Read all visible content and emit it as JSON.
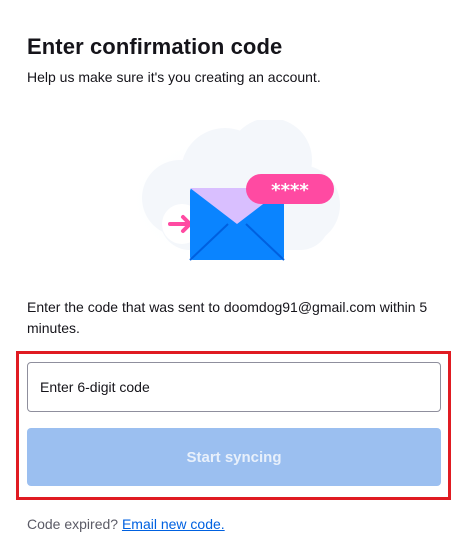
{
  "header": {
    "title": "Enter confirmation code",
    "subtitle": "Help us make sure it's you creating an account."
  },
  "illustration": {
    "icon": "envelope-with-code-icon",
    "code_mask": "****",
    "colors": {
      "cloud": "#f4f7fb",
      "envelope_body": "#0a84ff",
      "envelope_flap": "#d9bfff",
      "badge": "#ff4aa2",
      "arrow": "#ff4aa2"
    }
  },
  "instructions": "Enter the code that was sent to doomdog91@gmail.com within 5 minutes.",
  "form": {
    "code_placeholder": "Enter 6-digit code",
    "code_value": "",
    "submit_label": "Start syncing",
    "submit_disabled": true
  },
  "footer": {
    "prompt": "Code expired?",
    "link_label": "Email new code."
  },
  "colors": {
    "highlight_border": "#e01b22",
    "button_disabled_bg": "#9bbff0",
    "link": "#0061e0"
  }
}
